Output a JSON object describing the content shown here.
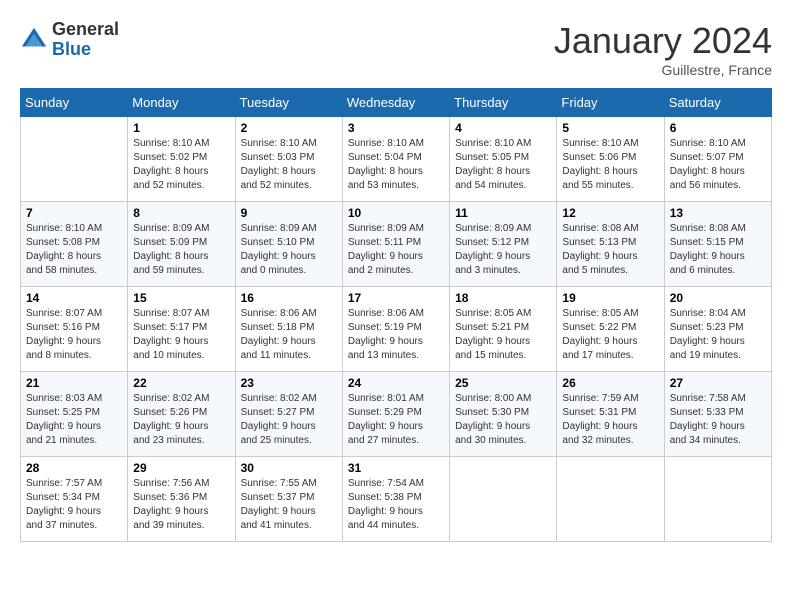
{
  "logo": {
    "general": "General",
    "blue": "Blue"
  },
  "title": "January 2024",
  "location": "Guillestre, France",
  "weekdays": [
    "Sunday",
    "Monday",
    "Tuesday",
    "Wednesday",
    "Thursday",
    "Friday",
    "Saturday"
  ],
  "weeks": [
    [
      {
        "day": "",
        "info": ""
      },
      {
        "day": "1",
        "info": "Sunrise: 8:10 AM\nSunset: 5:02 PM\nDaylight: 8 hours\nand 52 minutes."
      },
      {
        "day": "2",
        "info": "Sunrise: 8:10 AM\nSunset: 5:03 PM\nDaylight: 8 hours\nand 52 minutes."
      },
      {
        "day": "3",
        "info": "Sunrise: 8:10 AM\nSunset: 5:04 PM\nDaylight: 8 hours\nand 53 minutes."
      },
      {
        "day": "4",
        "info": "Sunrise: 8:10 AM\nSunset: 5:05 PM\nDaylight: 8 hours\nand 54 minutes."
      },
      {
        "day": "5",
        "info": "Sunrise: 8:10 AM\nSunset: 5:06 PM\nDaylight: 8 hours\nand 55 minutes."
      },
      {
        "day": "6",
        "info": "Sunrise: 8:10 AM\nSunset: 5:07 PM\nDaylight: 8 hours\nand 56 minutes."
      }
    ],
    [
      {
        "day": "7",
        "info": "Sunrise: 8:10 AM\nSunset: 5:08 PM\nDaylight: 8 hours\nand 58 minutes."
      },
      {
        "day": "8",
        "info": "Sunrise: 8:09 AM\nSunset: 5:09 PM\nDaylight: 8 hours\nand 59 minutes."
      },
      {
        "day": "9",
        "info": "Sunrise: 8:09 AM\nSunset: 5:10 PM\nDaylight: 9 hours\nand 0 minutes."
      },
      {
        "day": "10",
        "info": "Sunrise: 8:09 AM\nSunset: 5:11 PM\nDaylight: 9 hours\nand 2 minutes."
      },
      {
        "day": "11",
        "info": "Sunrise: 8:09 AM\nSunset: 5:12 PM\nDaylight: 9 hours\nand 3 minutes."
      },
      {
        "day": "12",
        "info": "Sunrise: 8:08 AM\nSunset: 5:13 PM\nDaylight: 9 hours\nand 5 minutes."
      },
      {
        "day": "13",
        "info": "Sunrise: 8:08 AM\nSunset: 5:15 PM\nDaylight: 9 hours\nand 6 minutes."
      }
    ],
    [
      {
        "day": "14",
        "info": "Sunrise: 8:07 AM\nSunset: 5:16 PM\nDaylight: 9 hours\nand 8 minutes."
      },
      {
        "day": "15",
        "info": "Sunrise: 8:07 AM\nSunset: 5:17 PM\nDaylight: 9 hours\nand 10 minutes."
      },
      {
        "day": "16",
        "info": "Sunrise: 8:06 AM\nSunset: 5:18 PM\nDaylight: 9 hours\nand 11 minutes."
      },
      {
        "day": "17",
        "info": "Sunrise: 8:06 AM\nSunset: 5:19 PM\nDaylight: 9 hours\nand 13 minutes."
      },
      {
        "day": "18",
        "info": "Sunrise: 8:05 AM\nSunset: 5:21 PM\nDaylight: 9 hours\nand 15 minutes."
      },
      {
        "day": "19",
        "info": "Sunrise: 8:05 AM\nSunset: 5:22 PM\nDaylight: 9 hours\nand 17 minutes."
      },
      {
        "day": "20",
        "info": "Sunrise: 8:04 AM\nSunset: 5:23 PM\nDaylight: 9 hours\nand 19 minutes."
      }
    ],
    [
      {
        "day": "21",
        "info": "Sunrise: 8:03 AM\nSunset: 5:25 PM\nDaylight: 9 hours\nand 21 minutes."
      },
      {
        "day": "22",
        "info": "Sunrise: 8:02 AM\nSunset: 5:26 PM\nDaylight: 9 hours\nand 23 minutes."
      },
      {
        "day": "23",
        "info": "Sunrise: 8:02 AM\nSunset: 5:27 PM\nDaylight: 9 hours\nand 25 minutes."
      },
      {
        "day": "24",
        "info": "Sunrise: 8:01 AM\nSunset: 5:29 PM\nDaylight: 9 hours\nand 27 minutes."
      },
      {
        "day": "25",
        "info": "Sunrise: 8:00 AM\nSunset: 5:30 PM\nDaylight: 9 hours\nand 30 minutes."
      },
      {
        "day": "26",
        "info": "Sunrise: 7:59 AM\nSunset: 5:31 PM\nDaylight: 9 hours\nand 32 minutes."
      },
      {
        "day": "27",
        "info": "Sunrise: 7:58 AM\nSunset: 5:33 PM\nDaylight: 9 hours\nand 34 minutes."
      }
    ],
    [
      {
        "day": "28",
        "info": "Sunrise: 7:57 AM\nSunset: 5:34 PM\nDaylight: 9 hours\nand 37 minutes."
      },
      {
        "day": "29",
        "info": "Sunrise: 7:56 AM\nSunset: 5:36 PM\nDaylight: 9 hours\nand 39 minutes."
      },
      {
        "day": "30",
        "info": "Sunrise: 7:55 AM\nSunset: 5:37 PM\nDaylight: 9 hours\nand 41 minutes."
      },
      {
        "day": "31",
        "info": "Sunrise: 7:54 AM\nSunset: 5:38 PM\nDaylight: 9 hours\nand 44 minutes."
      },
      {
        "day": "",
        "info": ""
      },
      {
        "day": "",
        "info": ""
      },
      {
        "day": "",
        "info": ""
      }
    ]
  ]
}
